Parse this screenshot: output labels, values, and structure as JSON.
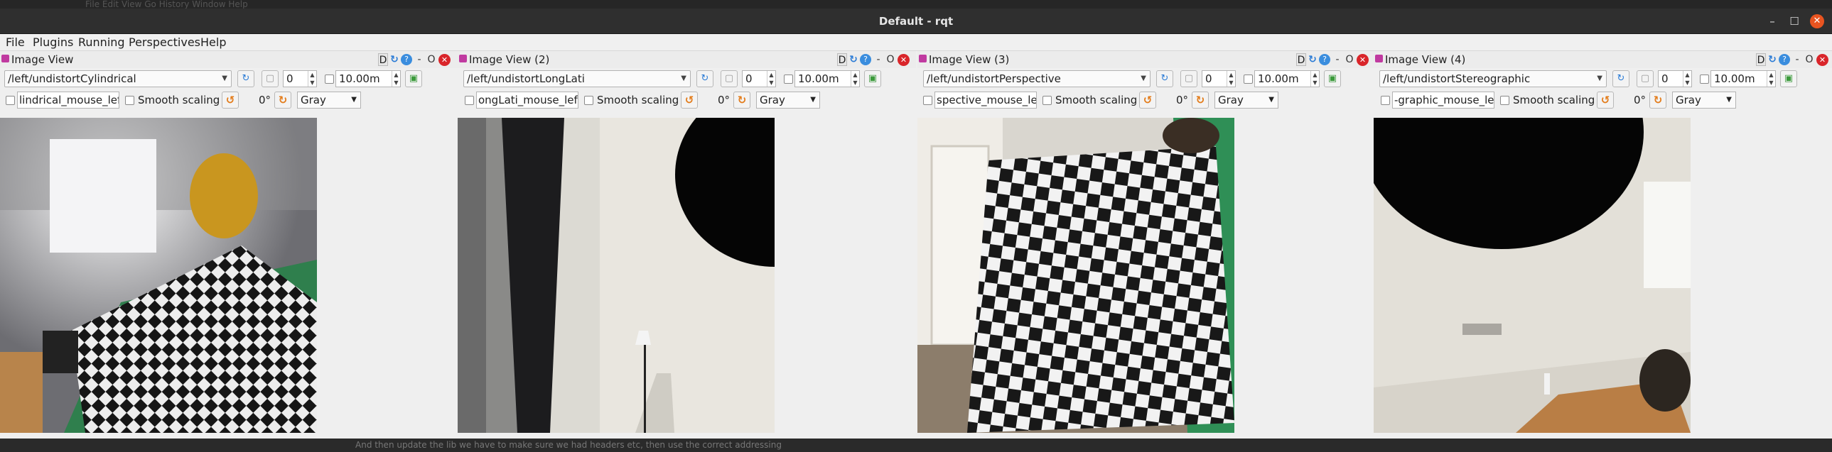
{
  "window": {
    "title": "Default - rqt",
    "min": "–",
    "max": "☐",
    "close": "✕",
    "top_strip_text": "File   Edit   View   Go   History   Window   Help"
  },
  "menubar": {
    "items": [
      "File",
      "Plugins",
      "Running",
      "Perspectives",
      "Help"
    ]
  },
  "dock_buttons": {
    "d": "D",
    "refresh": "↻",
    "help": "?",
    "float": "-",
    "o": "O",
    "close": "✕"
  },
  "toolbar_icons": {
    "refresh": "↻",
    "save": "▢",
    "rotate": "↺"
  },
  "panes": [
    {
      "title": "Image View",
      "topic": "/left/undistortCylindrical",
      "num": "0",
      "max_range": "10.00m",
      "mouse_topic": "lindrical_mouse_left",
      "smooth_label": "Smooth scaling",
      "rotation": "0°",
      "colormap": "Gray"
    },
    {
      "title": "Image View (2)",
      "topic": "/left/undistortLongLati",
      "num": "0",
      "max_range": "10.00m",
      "mouse_topic": "ongLati_mouse_left",
      "smooth_label": "Smooth scaling",
      "rotation": "0°",
      "colormap": "Gray"
    },
    {
      "title": "Image View (3)",
      "topic": "/left/undistortPerspective",
      "num": "0",
      "max_range": "10.00m",
      "mouse_topic": "spective_mouse_left",
      "smooth_label": "Smooth scaling",
      "rotation": "0°",
      "colormap": "Gray"
    },
    {
      "title": "Image View (4)",
      "topic": "/left/undistortStereographic",
      "num": "0",
      "max_range": "10.00m",
      "mouse_topic": "-graphic_mouse_left",
      "smooth_label": "Smooth scaling",
      "rotation": "0°",
      "colormap": "Gray"
    }
  ],
  "bottom_strip_text": "And then update the lib we have to make sure we had headers etc, then use the correct addressing"
}
